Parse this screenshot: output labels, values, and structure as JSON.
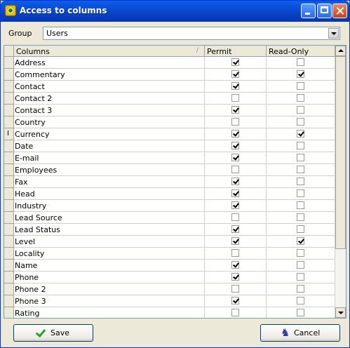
{
  "window": {
    "title": "Access to columns"
  },
  "group": {
    "label": "Group",
    "value": "Users"
  },
  "grid": {
    "headers": {
      "columns": "Columns",
      "permit": "Permit",
      "readonly": "Read-Only"
    },
    "rows": [
      {
        "name": "Address",
        "permit": true,
        "readonly": false
      },
      {
        "name": "Commentary",
        "permit": true,
        "readonly": true
      },
      {
        "name": "Contact",
        "permit": true,
        "readonly": false
      },
      {
        "name": "Contact 2",
        "permit": false,
        "readonly": false
      },
      {
        "name": "Contact 3",
        "permit": true,
        "readonly": false
      },
      {
        "name": "Country",
        "permit": false,
        "readonly": false
      },
      {
        "name": "Currency",
        "permit": true,
        "readonly": true,
        "cursor": true
      },
      {
        "name": "Date",
        "permit": true,
        "readonly": false
      },
      {
        "name": "E-mail",
        "permit": true,
        "readonly": false
      },
      {
        "name": "Employees",
        "permit": false,
        "readonly": false
      },
      {
        "name": "Fax",
        "permit": true,
        "readonly": false
      },
      {
        "name": "Head",
        "permit": true,
        "readonly": false
      },
      {
        "name": "Industry",
        "permit": true,
        "readonly": false
      },
      {
        "name": "Lead Source",
        "permit": false,
        "readonly": false
      },
      {
        "name": "Lead Status",
        "permit": true,
        "readonly": false
      },
      {
        "name": "Level",
        "permit": true,
        "readonly": true
      },
      {
        "name": "Locality",
        "permit": false,
        "readonly": false
      },
      {
        "name": "Name",
        "permit": true,
        "readonly": false
      },
      {
        "name": "Phone",
        "permit": true,
        "readonly": false
      },
      {
        "name": "Phone 2",
        "permit": false,
        "readonly": false
      },
      {
        "name": "Phone 3",
        "permit": true,
        "readonly": false
      },
      {
        "name": "Rating",
        "permit": false,
        "readonly": false
      }
    ]
  },
  "buttons": {
    "save": "Save",
    "cancel": "Cancel"
  },
  "icons": {
    "app": "app-icon",
    "save": "check-icon",
    "cancel": "runner-icon"
  },
  "colors": {
    "titlebar": "#0843C8",
    "accent": "#2AA02A"
  }
}
